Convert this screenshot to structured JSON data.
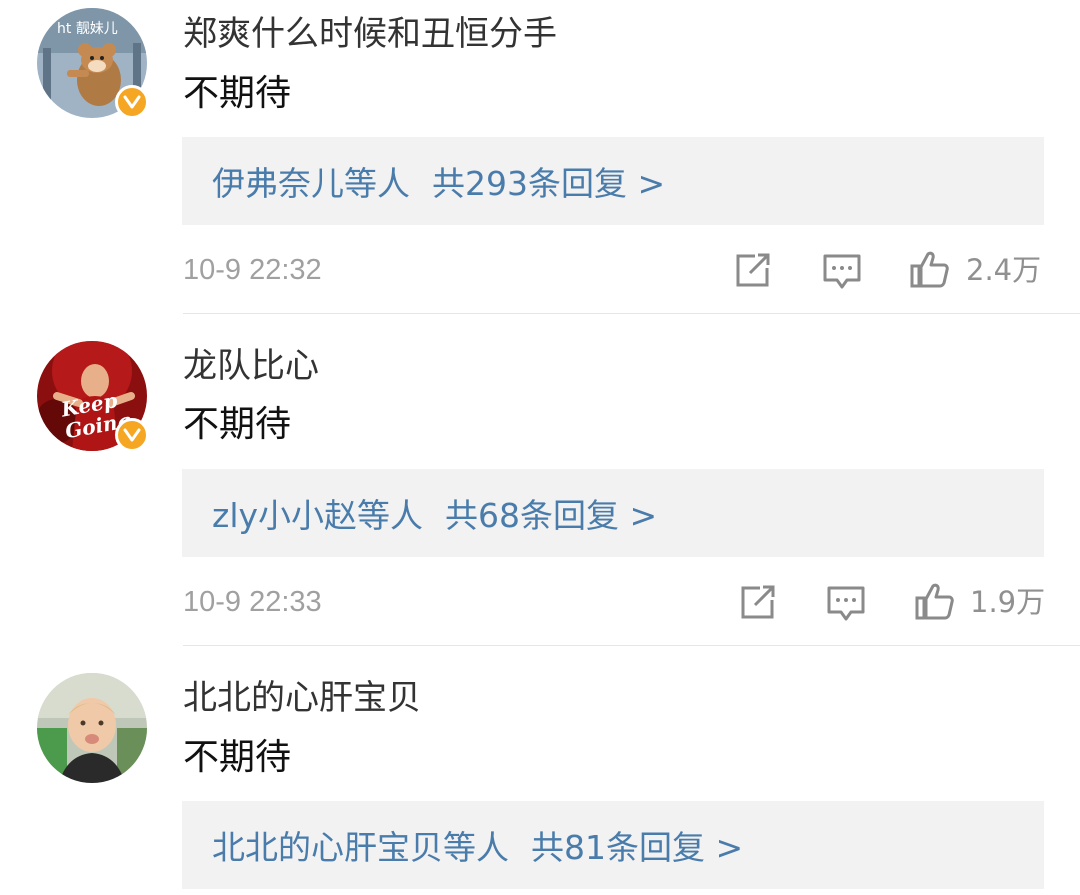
{
  "comments": [
    {
      "avatar_label": "ht 靓妹儿",
      "username": "郑爽什么时候和丑恒分手",
      "text": "不期待",
      "reply_names": "伊弗奈儿",
      "reply_mid": "等人",
      "reply_count": "共293条回复 >",
      "time": "10-9 22:32",
      "likes": "2.4万"
    },
    {
      "avatar_label": "Keep Going",
      "username": "龙队比心",
      "text": "不期待",
      "reply_names": "zly小小赵",
      "reply_mid": "等人",
      "reply_count": "共68条回复 >",
      "time": "10-9 22:33",
      "likes": "1.9万"
    },
    {
      "username": "北北的心肝宝贝",
      "text": "不期待",
      "reply_names": "北北的心肝宝贝",
      "reply_mid": "等人",
      "reply_count": "共81条回复 >"
    }
  ],
  "icons": {
    "share": "share-icon",
    "comment": "comment-icon",
    "like": "thumbs-up-icon",
    "verified": "verified-badge-icon"
  },
  "colors": {
    "link": "#4a7cab",
    "reply_bg": "#f2f2f2",
    "badge": "#f5a623",
    "meta": "#a0a0a0"
  }
}
